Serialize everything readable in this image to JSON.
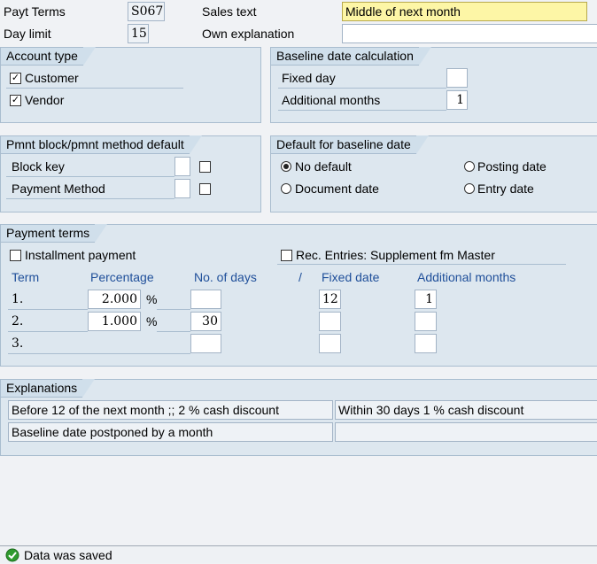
{
  "header": {
    "payt_terms_label": "Payt Terms",
    "payt_terms_value": "S067",
    "sales_text_label": "Sales text",
    "sales_text_value": "Middle of next month",
    "day_limit_label": "Day limit",
    "day_limit_value": "15",
    "own_explanation_label": "Own explanation",
    "own_explanation_value": ""
  },
  "account_type": {
    "title": "Account type",
    "customer_label": "Customer",
    "customer_checked": true,
    "vendor_label": "Vendor",
    "vendor_checked": true
  },
  "baseline_calc": {
    "title": "Baseline date calculation",
    "fixed_day_label": "Fixed day",
    "fixed_day_value": "",
    "additional_months_label": "Additional months",
    "additional_months_value": "1"
  },
  "pmnt_block": {
    "title": "Pmnt block/pmnt method default",
    "block_key_label": "Block key",
    "payment_method_label": "Payment Method"
  },
  "default_baseline": {
    "title": "Default for baseline date",
    "no_default": "No default",
    "posting_date": "Posting date",
    "document_date": "Document date",
    "entry_date": "Entry date"
  },
  "payment_terms": {
    "title": "Payment terms",
    "installment_label": "Installment payment",
    "rec_entries_label": "Rec. Entries: Supplement fm Master",
    "col_term": "Term",
    "col_percentage": "Percentage",
    "col_days": "No. of days",
    "col_sep": "/",
    "col_fixed": "Fixed date",
    "col_addmonths": "Additional months",
    "percent_sign": "%",
    "rows": [
      {
        "term": "1.",
        "percentage": "2.000",
        "days": "",
        "fixed": "12",
        "months": "1"
      },
      {
        "term": "2.",
        "percentage": "1.000",
        "days": "30",
        "fixed": "",
        "months": ""
      },
      {
        "term": "3.",
        "percentage": "",
        "days": "",
        "fixed": "",
        "months": ""
      }
    ]
  },
  "explanations": {
    "title": "Explanations",
    "line1_left": "Before 12 of the next month ;; 2 % cash discount",
    "line1_right": "Within 30 days 1 % cash discount",
    "line2_left": "Baseline date postponed by a month",
    "line2_right": ""
  },
  "status": {
    "message": "Data was saved",
    "color": "#2e9b2e"
  }
}
